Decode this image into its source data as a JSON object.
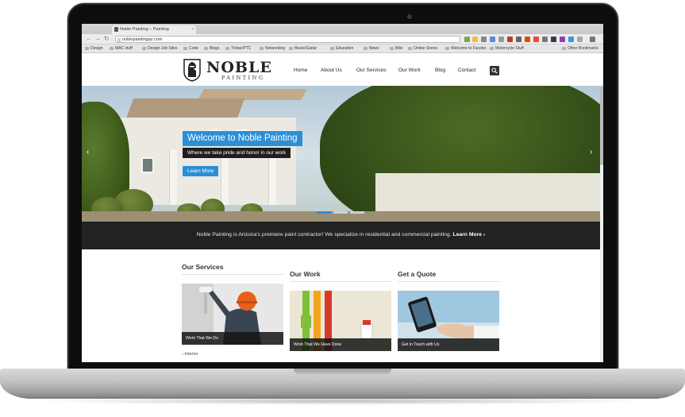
{
  "browser": {
    "tab_title": "Noble Painting – Painting",
    "tab_close": "×",
    "url": "noblepaintingaz.com",
    "bookmarks": [
      "Design",
      "MAC stuff",
      "Design Job Sites",
      "Code",
      "Blogs",
      "Tristar/PTC",
      "Networking",
      "Music/Guitar",
      "Education",
      "News",
      "Bills",
      "Online Stores",
      "Welcome to Facebo",
      "Motorcycle Stuff",
      "Other Bookmarks"
    ]
  },
  "site": {
    "logo_title": "NOBLE",
    "logo_subtitle": "PAINTING",
    "nav": [
      "Home",
      "About Us",
      "Our Services",
      "Our Work",
      "Blog",
      "Contact"
    ]
  },
  "hero": {
    "title": "Welcome to Noble Painting",
    "subtitle": "Where we take pride and honor in our work",
    "button": "Learn More",
    "prev": "‹",
    "next": "›"
  },
  "promo": {
    "text": "Noble Painting is Arizona's premiere paint contractor! We specialize in residential and commercial painting.",
    "link": "Learn More ›"
  },
  "sections": {
    "services": {
      "title": "Our Services",
      "caption": "Work That We Do",
      "list_item": "› Interior"
    },
    "work": {
      "title": "Our Work",
      "caption": "Work That We Have Done"
    },
    "quote": {
      "title": "Get a Quote",
      "caption": "Get in Touch with Us"
    }
  },
  "colors": {
    "accent": "#2b8fd6",
    "promo_bg": "#222222"
  }
}
